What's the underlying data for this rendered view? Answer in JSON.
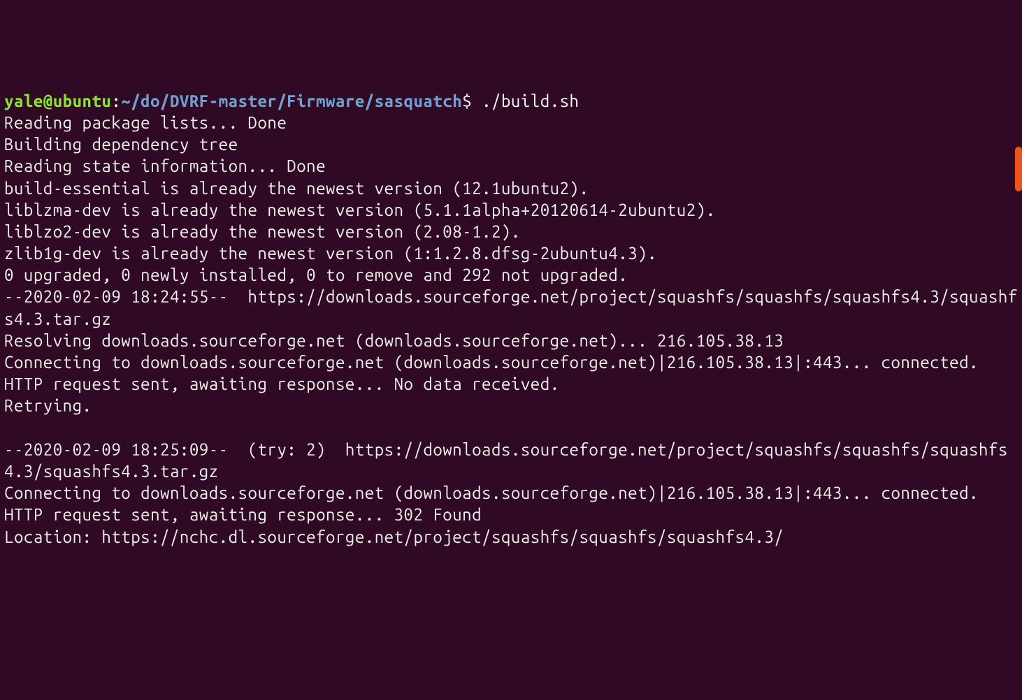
{
  "prompt": {
    "user": "yale@ubuntu",
    "colon": ":",
    "path": "~/do/DVRF-master/Firmware/sasquatch",
    "dollar": "$",
    "command": " ./build.sh"
  },
  "output_lines": [
    "Reading package lists... Done",
    "Building dependency tree",
    "Reading state information... Done",
    "build-essential is already the newest version (12.1ubuntu2).",
    "liblzma-dev is already the newest version (5.1.1alpha+20120614-2ubuntu2).",
    "liblzo2-dev is already the newest version (2.08-1.2).",
    "zlib1g-dev is already the newest version (1:1.2.8.dfsg-2ubuntu4.3).",
    "0 upgraded, 0 newly installed, 0 to remove and 292 not upgraded.",
    "--2020-02-09 18:24:55--  https://downloads.sourceforge.net/project/squashfs/squashfs/squashfs4.3/squashfs4.3.tar.gz",
    "Resolving downloads.sourceforge.net (downloads.sourceforge.net)... 216.105.38.13",
    "Connecting to downloads.sourceforge.net (downloads.sourceforge.net)|216.105.38.13|:443... connected.",
    "HTTP request sent, awaiting response... No data received.",
    "Retrying.",
    "",
    "--2020-02-09 18:25:09--  (try: 2)  https://downloads.sourceforge.net/project/squashfs/squashfs/squashfs4.3/squashfs4.3.tar.gz",
    "Connecting to downloads.sourceforge.net (downloads.sourceforge.net)|216.105.38.13|:443... connected.",
    "HTTP request sent, awaiting response... 302 Found",
    "Location: https://nchc.dl.sourceforge.net/project/squashfs/squashfs/squashfs4.3/"
  ]
}
